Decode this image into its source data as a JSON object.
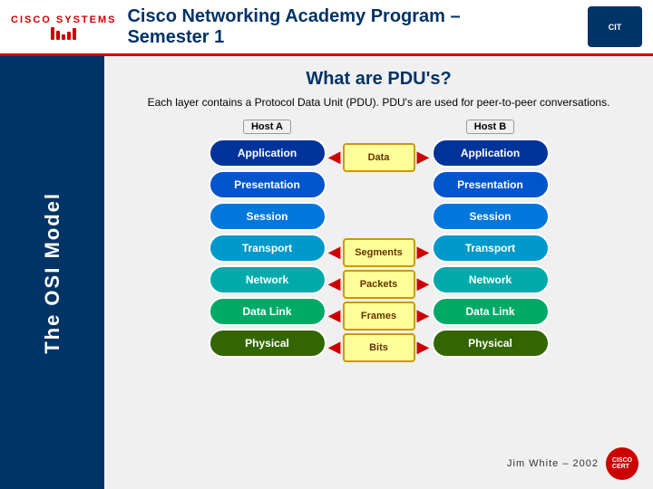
{
  "header": {
    "cisco_text": "CISCO SYSTEMS",
    "title_line1": "Cisco Networking Academy Program –",
    "title_line2": "Semester 1",
    "cit_label": "CIT"
  },
  "sidebar": {
    "label": "The OSI Model"
  },
  "content": {
    "page_title": "What are PDU's?",
    "description": "Each layer contains a Protocol Data Unit (PDU). PDU's are used for peer-to-peer conversations.",
    "host_a_label": "Host A",
    "host_b_label": "Host B",
    "layers": [
      {
        "name": "Application",
        "class": "layer-application"
      },
      {
        "name": "Presentation",
        "class": "layer-presentation"
      },
      {
        "name": "Session",
        "class": "layer-session"
      },
      {
        "name": "Transport",
        "class": "layer-transport"
      },
      {
        "name": "Network",
        "class": "layer-network"
      },
      {
        "name": "Data Link",
        "class": "layer-datalink"
      },
      {
        "name": "Physical",
        "class": "layer-physical"
      }
    ],
    "pdus": [
      {
        "label": "",
        "row": 0
      },
      {
        "label": "",
        "row": 1
      },
      {
        "label": "",
        "row": 2
      },
      {
        "label": "Data",
        "row": 0,
        "show": true
      },
      {
        "label": "Segments",
        "row": 1,
        "show": true
      },
      {
        "label": "Packets",
        "row": 2,
        "show": true
      },
      {
        "label": "Frames",
        "row": 3,
        "show": true
      },
      {
        "label": "Bits",
        "row": 4,
        "show": true
      }
    ]
  },
  "footer": {
    "text": "Jim  White – 2002"
  }
}
